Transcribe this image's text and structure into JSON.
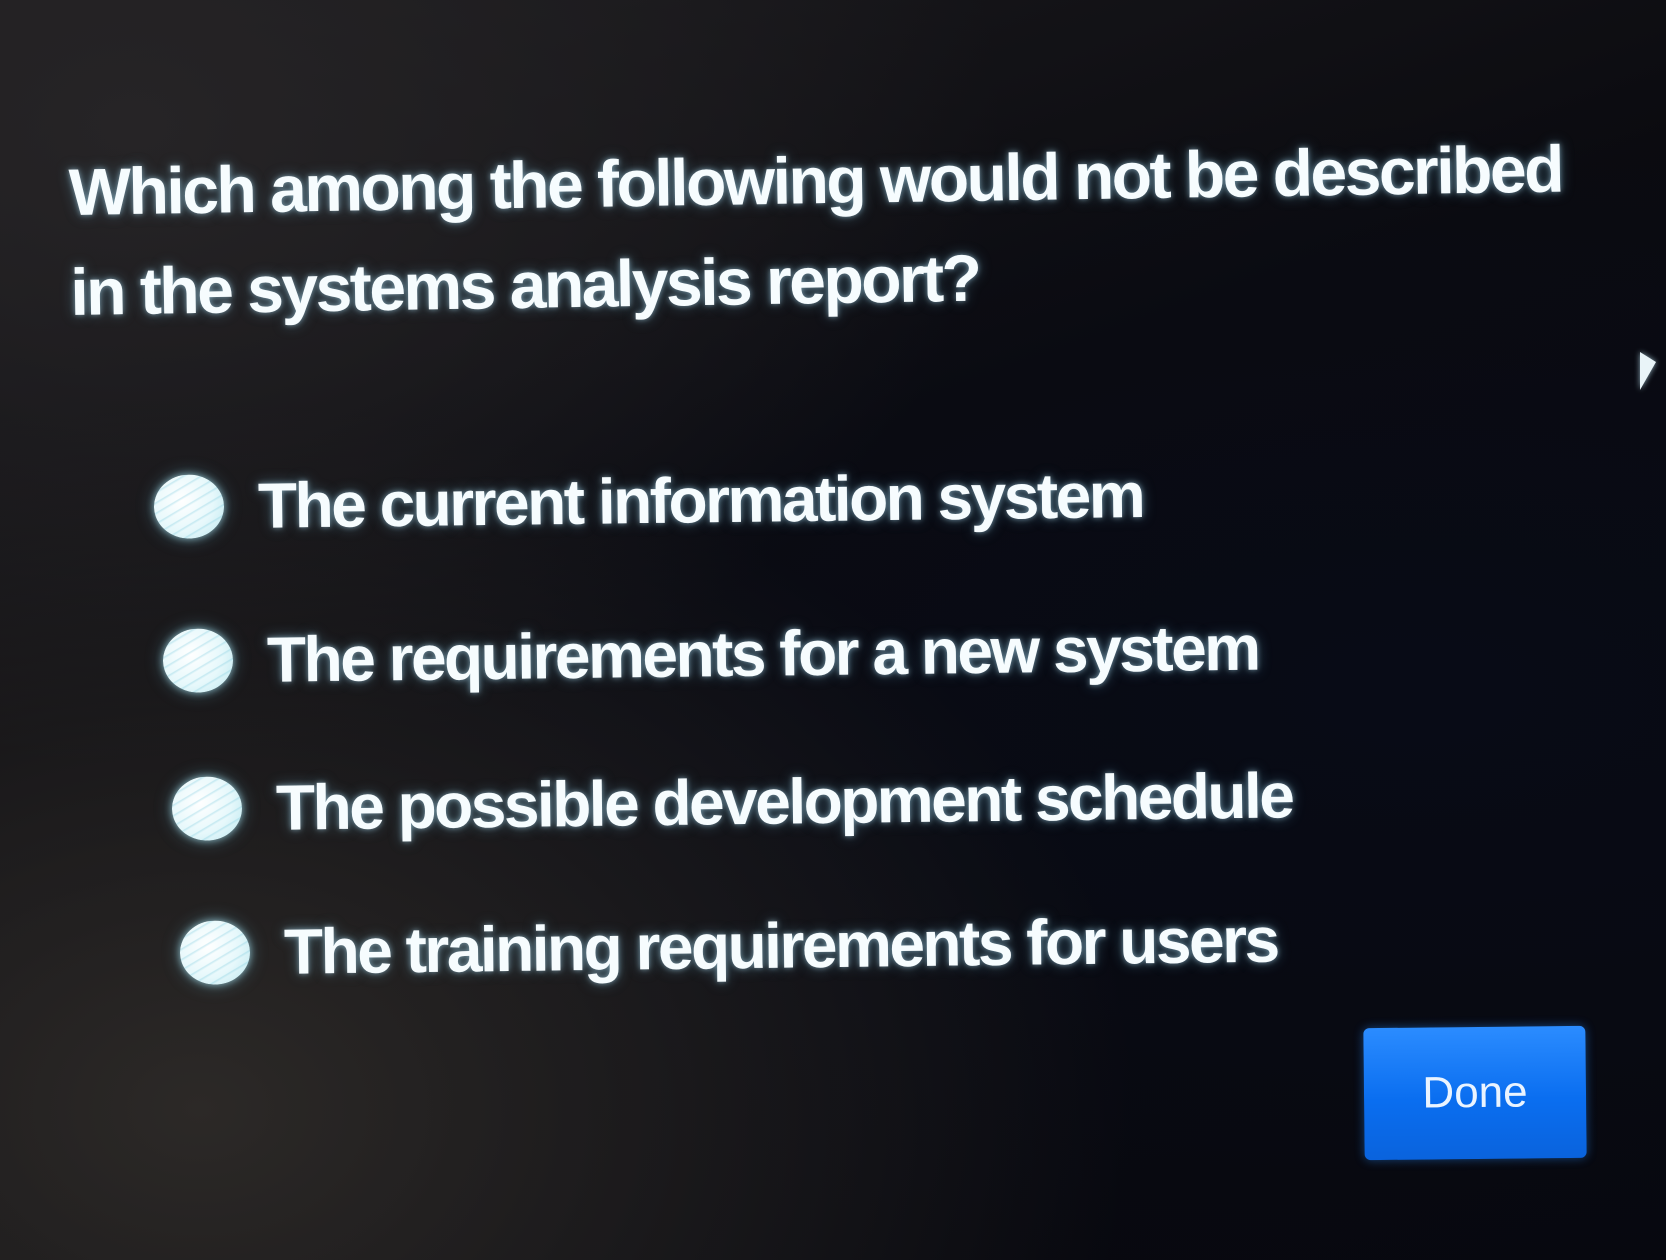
{
  "question": {
    "text": "Which among the following would not be described in the systems analysis report?"
  },
  "options": [
    {
      "label": "The current information system",
      "selected": false
    },
    {
      "label": "The requirements for a new system",
      "selected": false
    },
    {
      "label": "The possible development schedule",
      "selected": false
    },
    {
      "label": "The training requirements for users",
      "selected": false
    }
  ],
  "actions": {
    "done_label": "Done"
  },
  "colors": {
    "background": "#0b0b10",
    "text": "#f6fcfe",
    "radio_fill": "#e6f8fb",
    "button": "#0a6ef0",
    "button_text": "#eaf4ff"
  }
}
